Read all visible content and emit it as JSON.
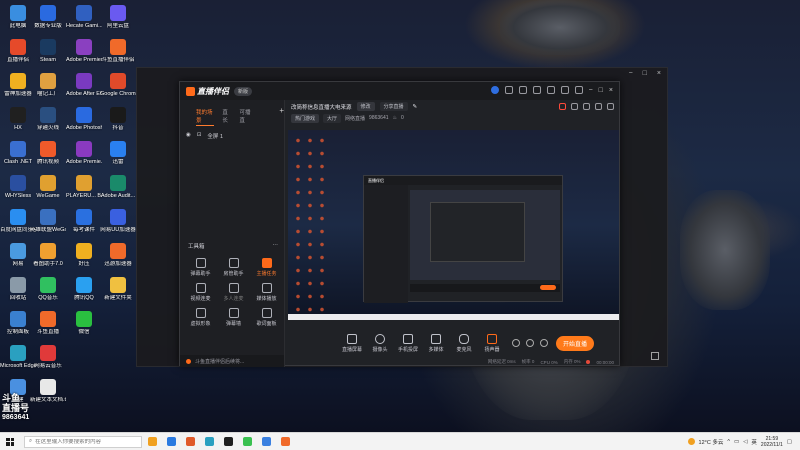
{
  "desktop": {
    "icons": [
      {
        "label": "此电脑",
        "color": "#3a8ee0"
      },
      {
        "label": "直播伴侣",
        "color": "#e64a2a"
      },
      {
        "label": "雷神加速器",
        "color": "#f0b020"
      },
      {
        "label": "HX",
        "color": "#202020"
      },
      {
        "label": "Clash .NET",
        "color": "#3a6fd0"
      },
      {
        "label": "WHYSless",
        "color": "#2a4fa0"
      },
      {
        "label": "百度网盘同步空间",
        "color": "#2a8ef0"
      },
      {
        "label": "网易",
        "color": "#4a9ae0"
      },
      {
        "label": "回收站",
        "color": "#8a9aa8"
      },
      {
        "label": "控制面板",
        "color": "#3a80d0"
      },
      {
        "label": "Microsoft Edge",
        "color": "#2aa0c0"
      },
      {
        "label": "新建",
        "color": "#4a90e0"
      },
      {
        "label": "数据专业版",
        "color": "#2a6ae0"
      },
      {
        "label": "Steam",
        "color": "#1a3a60"
      },
      {
        "label": "喵记工厂",
        "color": "#e0a040"
      },
      {
        "label": "穿越火线",
        "color": "#2a4f80"
      },
      {
        "label": "腾讯视频",
        "color": "#f05a2a"
      },
      {
        "label": "WeGame",
        "color": "#e0a030"
      },
      {
        "label": "英雄联盟WeGame版",
        "color": "#3a70c0"
      },
      {
        "label": "看图助手7.0",
        "color": "#f0a030"
      },
      {
        "label": "QQ音乐",
        "color": "#30c060"
      },
      {
        "label": "斗鱼直播",
        "color": "#f06a2a"
      },
      {
        "label": "网易云音乐",
        "color": "#e03a3a"
      },
      {
        "label": "新建文本文档.txt",
        "color": "#e8e8e8"
      },
      {
        "label": "Hecate Gami...",
        "color": "#3060c0"
      },
      {
        "label": "Adobe Premiere P...",
        "color": "#8a40c0"
      },
      {
        "label": "Adobe After Effects CC ...",
        "color": "#7a3ac0"
      },
      {
        "label": "Adobe Photosh...",
        "color": "#2a6ae0"
      },
      {
        "label": "Adobe Premie...",
        "color": "#8a3ac0"
      },
      {
        "label": "PLAYERU... BATTLEGR...",
        "color": "#e0a030"
      },
      {
        "label": "每考课件",
        "color": "#2a70e0"
      },
      {
        "label": "好压",
        "color": "#f0b020"
      },
      {
        "label": "腾讯QQ",
        "color": "#2aa0f0"
      },
      {
        "label": "微信",
        "color": "#2ac040"
      },
      {
        "label": "阿里云盘",
        "color": "#6a5af0"
      },
      {
        "label": "斗鱼直播伴侣",
        "color": "#f06a2a"
      },
      {
        "label": "Google Chrome",
        "color": "#e04a2a"
      },
      {
        "label": "抖音",
        "color": "#1a1a1a"
      },
      {
        "label": "迅雷",
        "color": "#2a80f0"
      },
      {
        "label": "Adobe Audit...",
        "color": "#1a8a6a"
      },
      {
        "label": "网易UU加速器",
        "color": "#3a60e0"
      },
      {
        "label": "迅游加速器",
        "color": "#f06a2a"
      },
      {
        "label": "新建文件夹",
        "color": "#f0c040"
      }
    ]
  },
  "app": {
    "name": "直播伴侣",
    "version_badge": "新版",
    "left_tabs": [
      "我的场景",
      "直长",
      "可播直"
    ],
    "active_tab": 0,
    "scene": "全屏 1",
    "toolbox_title": "工具箱",
    "tools": [
      {
        "label": "弹幕助手",
        "style": "normal"
      },
      {
        "label": "房管助手",
        "style": "normal"
      },
      {
        "label": "主播任务",
        "style": "orange"
      },
      {
        "label": "视频连麦",
        "style": "normal"
      },
      {
        "label": "多人连麦",
        "style": "dim"
      },
      {
        "label": "媒体播放",
        "style": "normal"
      },
      {
        "label": "虚拟形象",
        "style": "normal"
      },
      {
        "label": "弹幕墙",
        "style": "normal"
      },
      {
        "label": "歌词面板",
        "style": "normal"
      }
    ],
    "ad_text": "斗鱼直播伴侣后续将...",
    "room_title": "改简称信息直播大电来源",
    "room_edit_label": "修改",
    "room_share_label": "分享直播",
    "info_pills": [
      "热门游戏",
      "大厅",
      "网络直播"
    ],
    "room_id": "9863641",
    "follow_count": "0",
    "bottom_tools": [
      "直播屏幕",
      "摄像头",
      "手机投屏",
      "多媒体",
      "麦克风",
      "扬声器"
    ],
    "live_button": "开始直播",
    "status_items": [
      "网络延迟 0ms",
      "帧率 0",
      "CPU 0%",
      "内存 0%",
      "00:00:00"
    ]
  },
  "watermark": {
    "line1": "斗鱼",
    "line2": "直播号",
    "number": "9863641"
  },
  "taskbar": {
    "search_placeholder": "在这里输入你要搜索的内容",
    "weather": "12°C 多云",
    "time": "21:59",
    "date": "2022/11/1",
    "apps": [
      "#f0a020",
      "#2a7ae0",
      "#e05a2a",
      "#2aa0c0",
      "#202020",
      "#3ac050",
      "#3a80e0",
      "#f06a2a"
    ]
  }
}
